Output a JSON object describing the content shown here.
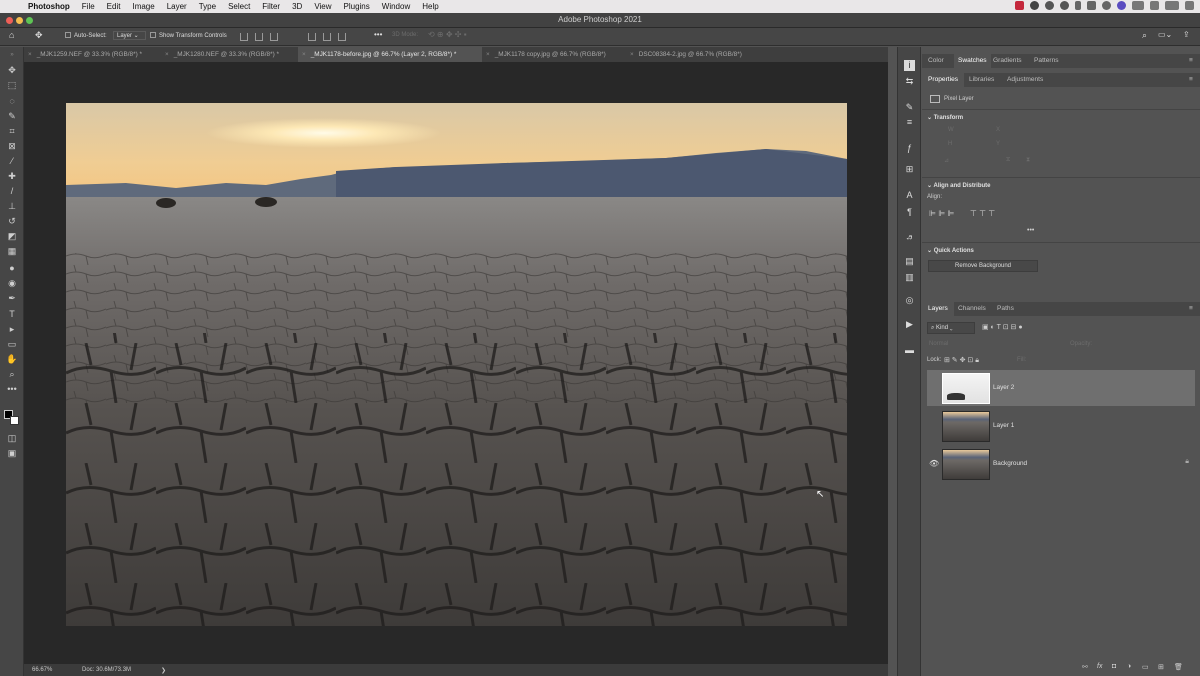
{
  "menubar": {
    "apple": "",
    "app": "Photoshop",
    "items": [
      "File",
      "Edit",
      "Image",
      "Layer",
      "Type",
      "Select",
      "Filter",
      "3D",
      "View",
      "Plugins",
      "Window",
      "Help"
    ]
  },
  "window": {
    "title": "Adobe Photoshop 2021"
  },
  "options": {
    "auto_select_label": "Auto-Select:",
    "auto_select_value": "Layer",
    "transform_controls_label": "Show Transform Controls",
    "mode_3d": "3D Mode:"
  },
  "tabs": [
    {
      "label": "_MJK1259.NEF @ 33.3% (RGB/8*) *"
    },
    {
      "label": "_MJK1280.NEF @ 33.3% (RGB/8*) *"
    },
    {
      "label": "_MJK1178-before.jpg @ 66.7% (Layer 2, RGB/8*) *"
    },
    {
      "label": "_MJK1178 copy.jpg @ 66.7% (RGB/8*)"
    },
    {
      "label": "DSC08384-2.jpg @ 66.7% (RGB/8*)"
    }
  ],
  "status": {
    "zoom": "66.67%",
    "doc": "Doc: 30.6M/73.3M",
    "arrow": "❯"
  },
  "panels": {
    "top_tabs": [
      "Color",
      "Swatches",
      "Gradients",
      "Patterns"
    ],
    "prop_tabs": [
      "Properties",
      "Libraries",
      "Adjustments"
    ],
    "pixel_layer": "Pixel Layer",
    "transform": "Transform",
    "transform_fields": {
      "w": "W",
      "h": "H",
      "x": "X",
      "y": "Y"
    },
    "align_distribute": "Align and Distribute",
    "align": "Align:",
    "more": "•••",
    "quick_actions": "Quick Actions",
    "remove_bg": "Remove Background",
    "layer_tabs": [
      "Layers",
      "Channels",
      "Paths"
    ],
    "kind": "Kind",
    "blend_mode": "Normal",
    "opacity": "Opacity:",
    "lock": "Lock:",
    "fill": "Fill:",
    "layers": [
      {
        "name": "Layer 2",
        "selected": true,
        "visible": false
      },
      {
        "name": "Layer 1",
        "selected": false,
        "visible": false
      },
      {
        "name": "Background",
        "selected": false,
        "visible": true
      }
    ],
    "fx": "fx"
  },
  "colors": {
    "menubar_bg": "#e9e7e8",
    "panel_bg": "#535353",
    "canvas_bg": "#282828",
    "close": "#ee5f57",
    "min": "#f5bd4f",
    "max": "#5ec454"
  }
}
